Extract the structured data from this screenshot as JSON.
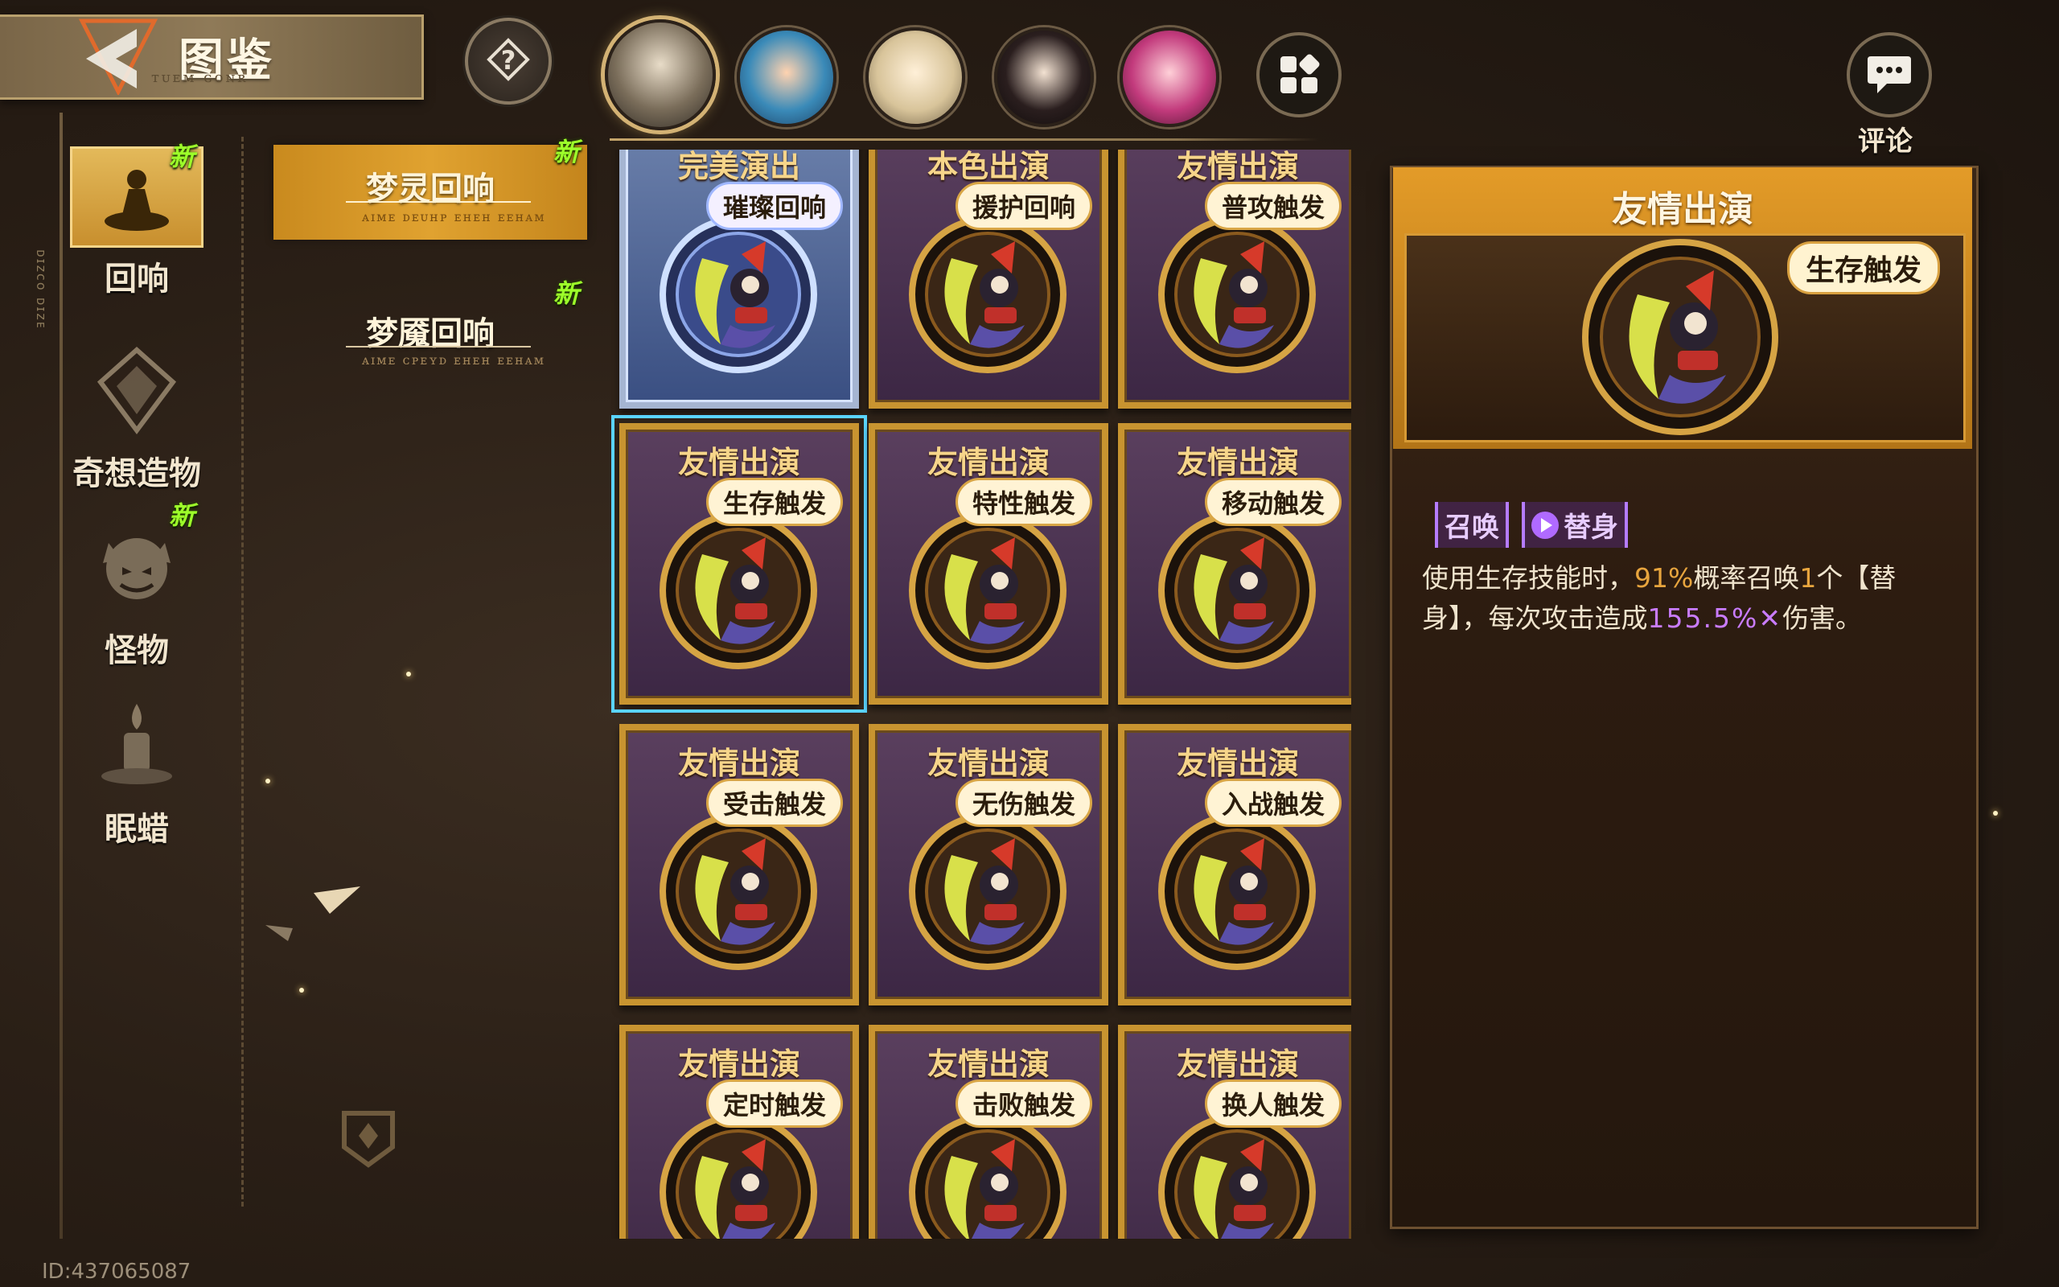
{
  "header": {
    "title": "图鉴",
    "title_sub": "ᴛᴜᴇᴍ ɢᴏɴʀ"
  },
  "categories": [
    {
      "id": "echo",
      "label": "回响",
      "new": "新"
    },
    {
      "id": "artifact",
      "label": "奇想造物",
      "new": ""
    },
    {
      "id": "monster",
      "label": "怪物",
      "new": "新"
    },
    {
      "id": "candle",
      "label": "眠蜡",
      "new": ""
    }
  ],
  "subtabs": [
    {
      "label": "梦灵回响",
      "sub": "ᴀɪᴍᴇ ᴅᴇᴜʜᴘ ᴇʜᴇʜ ᴇᴇʜᴀᴍ",
      "new": "新",
      "active": true
    },
    {
      "label": "梦魇回响",
      "sub": "ᴀɪᴍᴇ ᴄᴘᴇʏᴅ ᴇʜᴇʜ ᴇᴇʜᴀᴍ",
      "new": "新",
      "active": false
    }
  ],
  "cards": [
    {
      "title": "完美演出",
      "tag": "璀璨回响",
      "style": "silver"
    },
    {
      "title": "本色出演",
      "tag": "援护回响",
      "style": "gold"
    },
    {
      "title": "友情出演",
      "tag": "普攻触发",
      "style": "gold"
    },
    {
      "title": "友情出演",
      "tag": "生存触发",
      "style": "gold",
      "selected": true
    },
    {
      "title": "友情出演",
      "tag": "特性触发",
      "style": "gold"
    },
    {
      "title": "友情出演",
      "tag": "移动触发",
      "style": "gold"
    },
    {
      "title": "友情出演",
      "tag": "受击触发",
      "style": "gold"
    },
    {
      "title": "友情出演",
      "tag": "无伤触发",
      "style": "gold"
    },
    {
      "title": "友情出演",
      "tag": "入战触发",
      "style": "gold"
    },
    {
      "title": "友情出演",
      "tag": "定时触发",
      "style": "gold"
    },
    {
      "title": "友情出演",
      "tag": "击败触发",
      "style": "gold"
    },
    {
      "title": "友情出演",
      "tag": "换人触发",
      "style": "gold"
    }
  ],
  "comment": {
    "label": "评论"
  },
  "detail": {
    "title": "友情出演",
    "tag": "生存触发",
    "keyword_1": "召唤",
    "keyword_2": "替身",
    "desc_part1": "使用生存技能时，",
    "desc_pct": "91%",
    "desc_part2": "概率召唤",
    "desc_count": "1",
    "desc_part3": "个【替身】，每次攻击造成",
    "desc_dmg": "155.5%",
    "desc_part4": "伤害。"
  },
  "user_id": "ID:437065087",
  "colors": {
    "gold": "#c89430",
    "accent_purple": "#c97cff",
    "new_green": "#9dff2a",
    "selected_blue": "#5ad4ff"
  }
}
